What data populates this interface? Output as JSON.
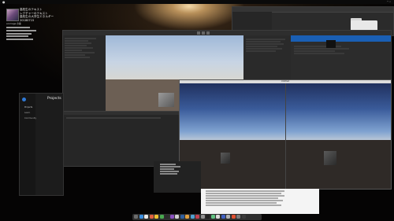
{
  "desktop_items": [
    {
      "label": "高校生のテキスト"
    },
    {
      "label": "レクチャーのテキスト"
    },
    {
      "label": "高校生の大学生エネルギー"
    },
    {
      "label": "20180715"
    }
  ],
  "desktop_file_list": [
    "ar.image の事"
  ],
  "projects_window": {
    "title": "Projects",
    "sidebar": [
      "Projects",
      "Learn",
      "Community"
    ]
  },
  "game_window": {
    "title": "Untitled"
  },
  "colors": {
    "unity_bg": "#232323",
    "accent": "#1a5fb4"
  },
  "icons": [
    "folder-icon",
    "apple-icon",
    "search-icon",
    "wifi-icon"
  ]
}
